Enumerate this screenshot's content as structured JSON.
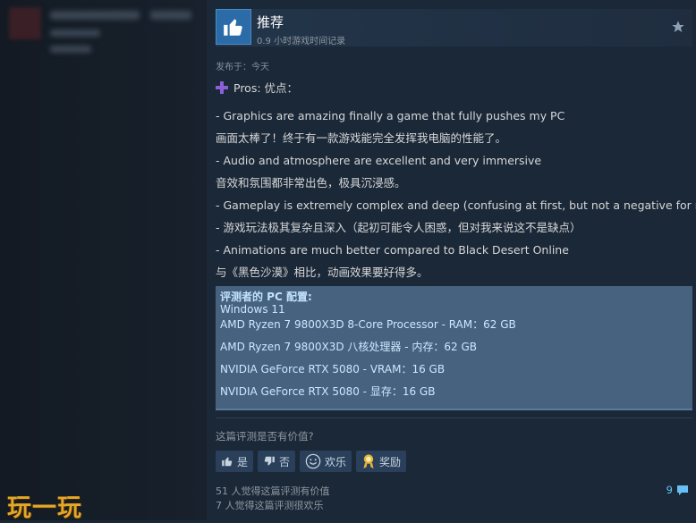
{
  "header": {
    "vote_title": "推荐",
    "playtime": "0.9 小时游戏时间记录"
  },
  "posted": "发布于：今天",
  "pros_label": "Pros:  优点：",
  "review_lines": [
    "- Graphics are amazing finally a game that fully pushes my PC",
    "画面太棒了！终于有一款游戏能完全发挥我电脑的性能了。",
    "- Audio and atmosphere are excellent and very immersive",
    "音效和氛围都非常出色，极具沉浸感。",
    "- Gameplay is extremely complex and deep (confusing at first, but not a negative for me)",
    "- 游戏玩法极其复杂且深入（起初可能令人困惑，但对我来说这不是缺点）",
    "- Animations are much better compared to Black Desert Online",
    "与《黑色沙漠》相比，动画效果要好得多。"
  ],
  "specs": {
    "title": "评测者的 PC 配置:",
    "os": "Windows 11",
    "lines": [
      "AMD Ryzen 7 9800X3D 8-Core Processor - RAM：62 GB",
      "AMD Ryzen 7 9800X3D 八核处理器 - 内存：62 GB",
      "NVIDIA GeForce RTX 5080 - VRAM：16 GB",
      "NVIDIA GeForce RTX 5080 - 显存：16 GB"
    ]
  },
  "helpful": {
    "question": "这篇评测是否有价值?",
    "yes": "是",
    "no": "否",
    "funny": "欢乐",
    "award": "奖励"
  },
  "stats": {
    "helpful_count": "51 人觉得这篇评测有价值",
    "funny_count": "7 人觉得这篇评测很欢乐"
  },
  "comments_count": "9",
  "watermark": "玩一玩",
  "colors": {
    "background": "#1b2838",
    "specs_bg": "#46627e",
    "link_blue": "#66c0f4",
    "recommend_blue": "#2b6ca8"
  }
}
